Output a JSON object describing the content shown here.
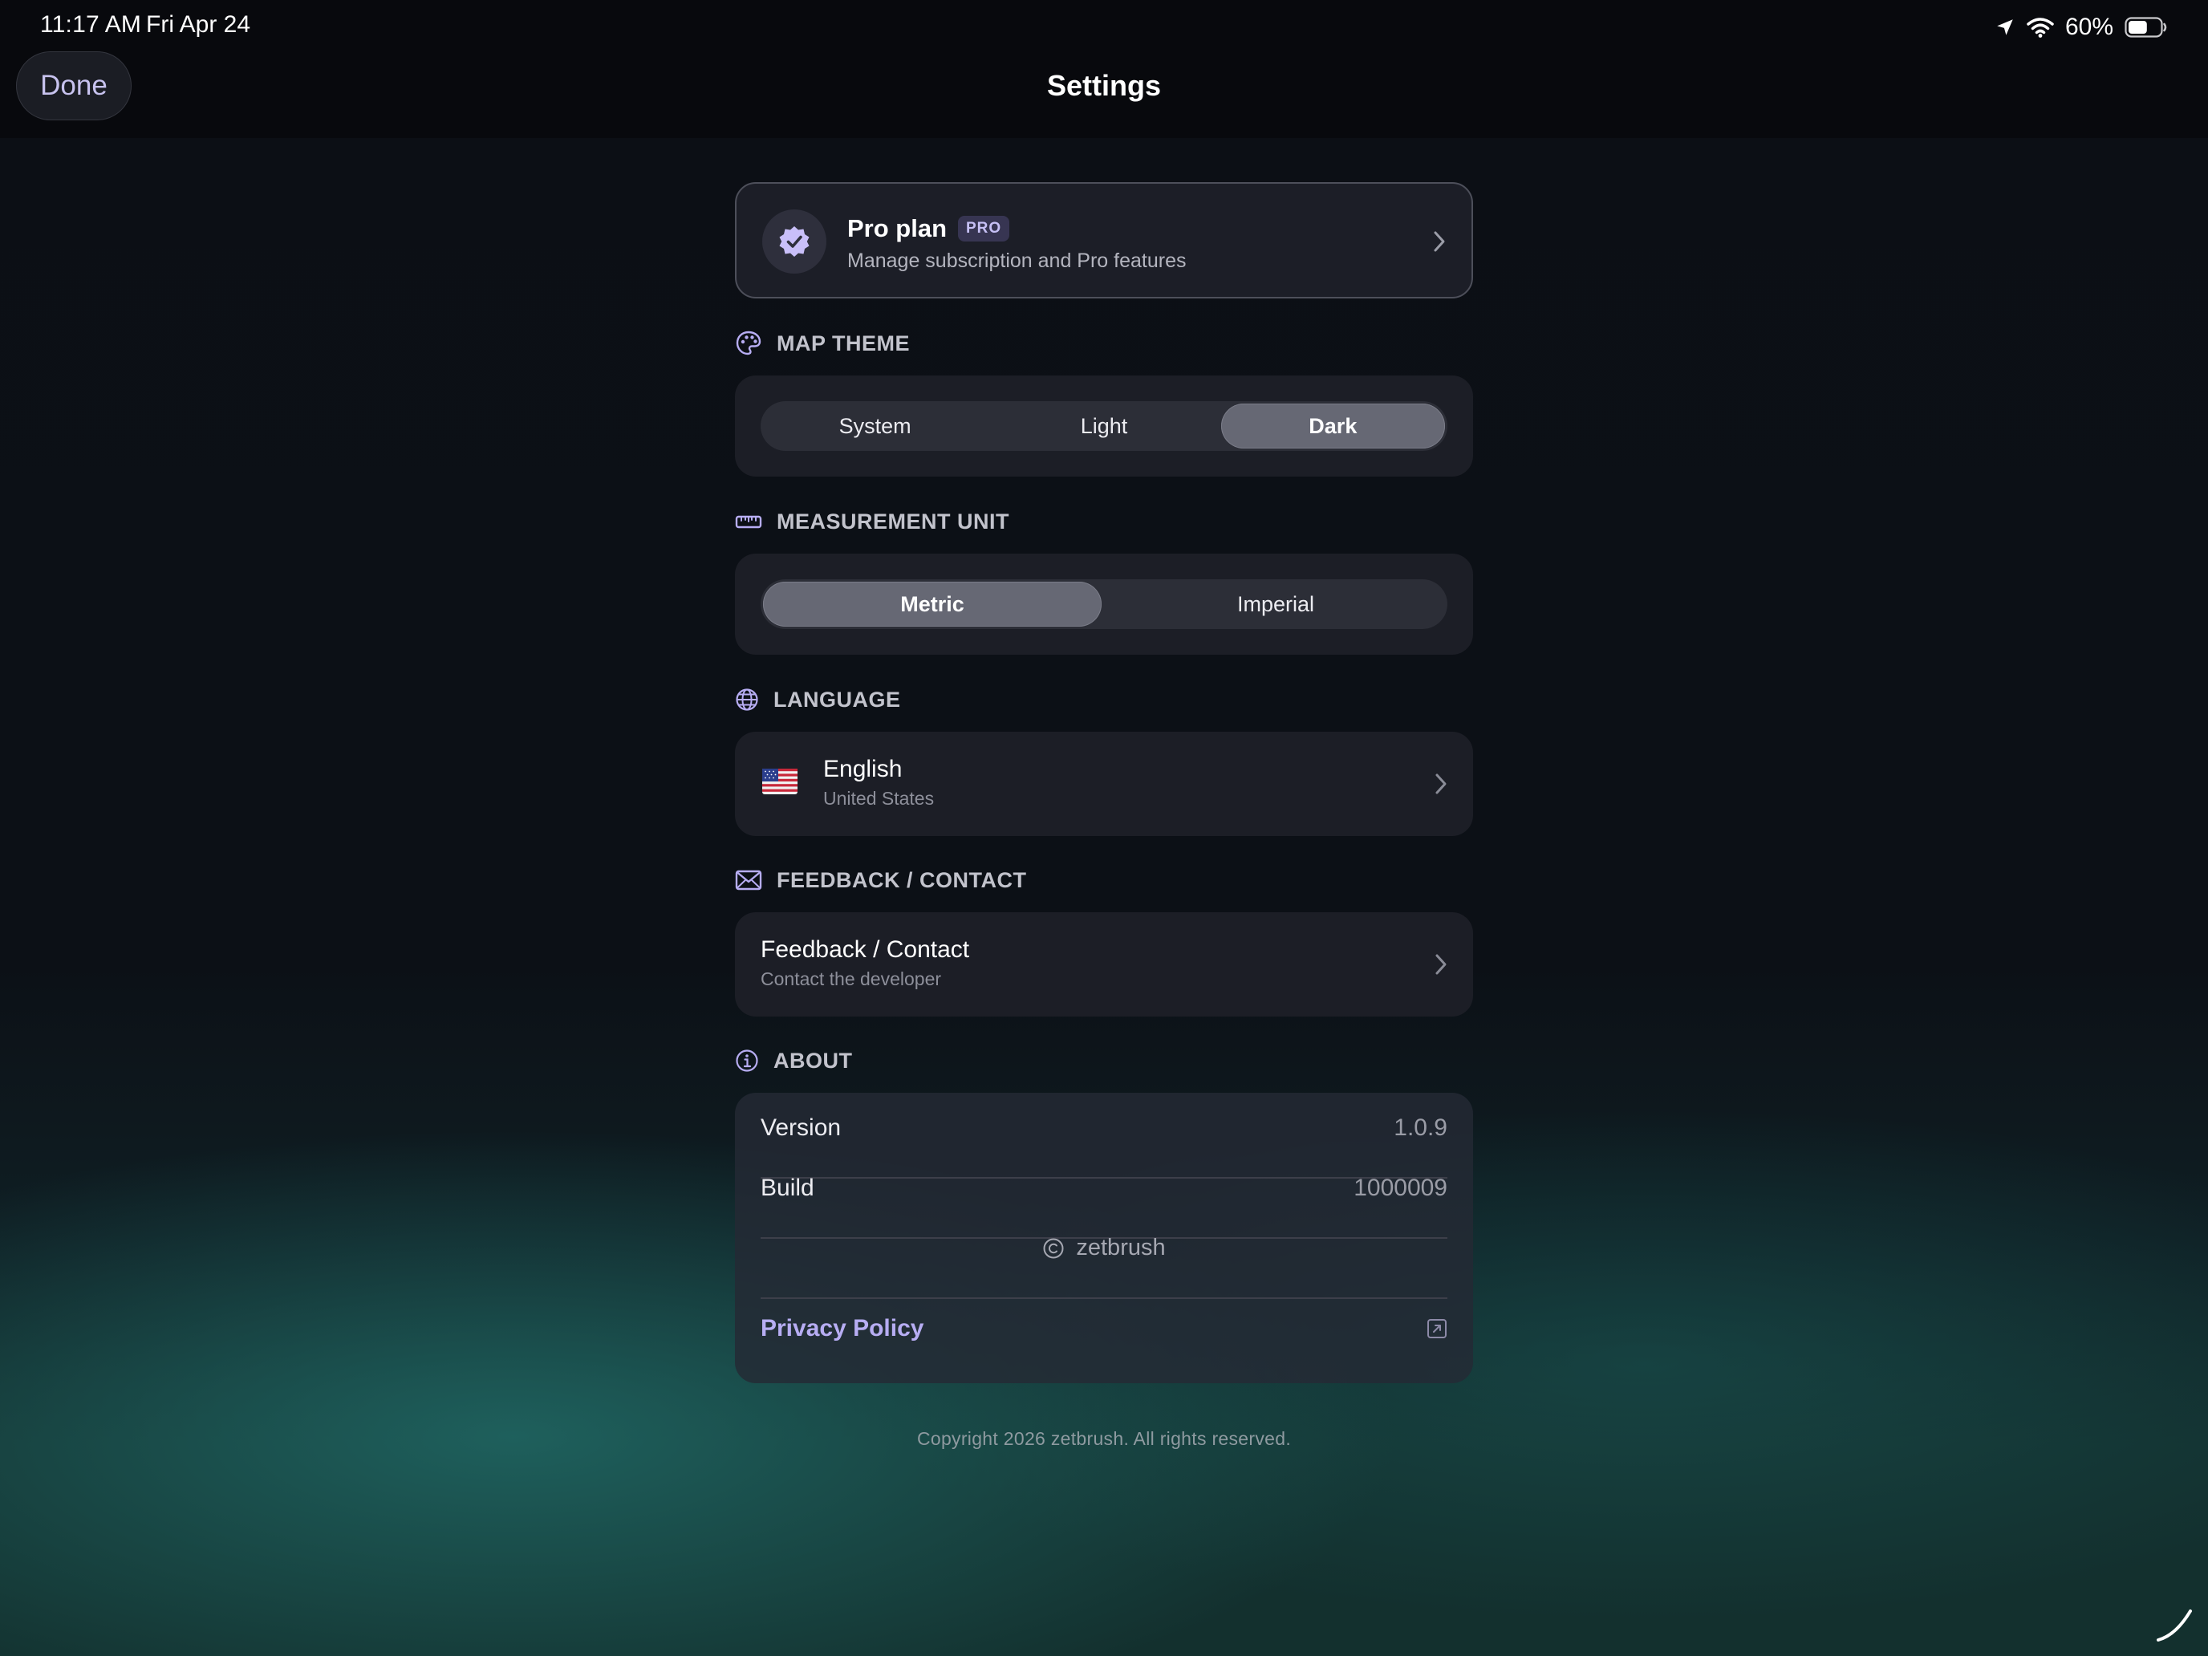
{
  "status_bar": {
    "time": "11:17 AM",
    "date": "Fri Apr 24",
    "battery": "60%",
    "battery_level": 0.6
  },
  "header": {
    "done_label": "Done",
    "title": "Settings"
  },
  "pro_plan": {
    "title": "Pro plan",
    "tag": "PRO",
    "subtitle": "Manage subscription and Pro features"
  },
  "map_theme": {
    "heading": "MAP THEME",
    "options": [
      "System",
      "Light",
      "Dark"
    ],
    "selected": "Dark"
  },
  "measurement_unit": {
    "heading": "MEASUREMENT UNIT",
    "options": [
      "Metric",
      "Imperial"
    ],
    "selected": "Metric"
  },
  "language": {
    "heading": "LANGUAGE",
    "name": "English",
    "region": "United States",
    "flag_icon": "us-flag-icon"
  },
  "feedback": {
    "heading": "FEEDBACK / CONTACT",
    "title": "Feedback / Contact",
    "subtitle": "Contact the developer"
  },
  "about": {
    "heading": "ABOUT",
    "version_label": "Version",
    "version_value": "1.0.9",
    "build_label": "Build",
    "build_value": "1000009",
    "credit": "zetbrush",
    "privacy_label": "Privacy Policy"
  },
  "footer": {
    "copyright": "Copyright 2026 zetbrush. All rights reserved."
  },
  "colors": {
    "accent": "#b7adf3",
    "background": "#0c1016",
    "card": "#1c1e26"
  }
}
